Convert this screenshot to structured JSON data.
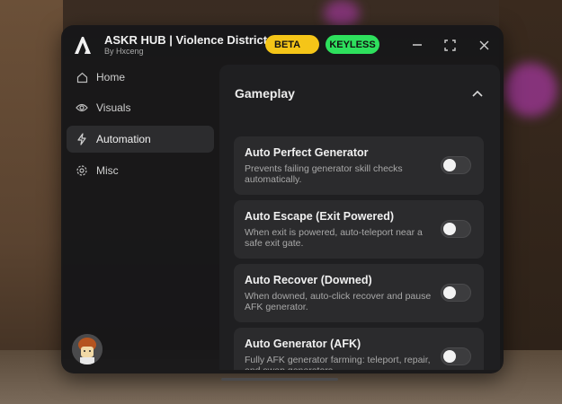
{
  "app": {
    "title": "ASKR HUB | Violence District",
    "subtitle": "By Hxceng",
    "badges": {
      "beta": "BETA",
      "keyless": "KEYLESS"
    },
    "colors": {
      "beta": "#f5c518",
      "keyless": "#2ee05d",
      "window_bg": "#161618",
      "card_bg": "#2b2b2d"
    }
  },
  "sidebar": {
    "items": [
      {
        "label": "Home",
        "icon": "home-icon"
      },
      {
        "label": "Visuals",
        "icon": "eye-icon"
      },
      {
        "label": "Automation",
        "icon": "lightning-icon",
        "active": true
      },
      {
        "label": "Misc",
        "icon": "gear-icon"
      }
    ]
  },
  "main": {
    "section_title": "Gameplay",
    "cards": [
      {
        "title": "Auto Perfect Generator",
        "description": "Prevents failing generator skill checks automatically.",
        "enabled": false
      },
      {
        "title": "Auto Escape (Exit Powered)",
        "description": "When exit is powered, auto-teleport near a safe exit gate.",
        "enabled": false
      },
      {
        "title": "Auto Recover (Downed)",
        "description": "When downed, auto-click recover and pause AFK generator.",
        "enabled": false
      },
      {
        "title": "Auto Generator (AFK)",
        "description": "Fully AFK generator farming: teleport, repair, and swap generators.",
        "enabled": false
      }
    ]
  }
}
